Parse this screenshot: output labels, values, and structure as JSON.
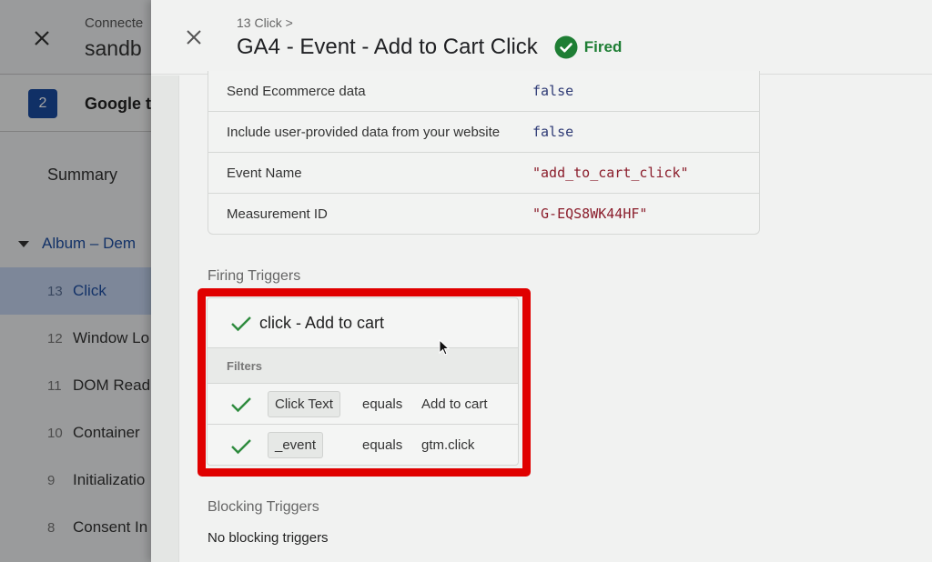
{
  "background_app": {
    "header": {
      "connected_label": "Connecte",
      "site_name": "sandb"
    },
    "container": {
      "badge": "2",
      "name": "Google t"
    },
    "summary_label": "Summary",
    "page_group": "Album – Dem",
    "events": [
      {
        "num": "13",
        "label": "Click",
        "active": true
      },
      {
        "num": "12",
        "label": "Window Lo"
      },
      {
        "num": "11",
        "label": "DOM Read"
      },
      {
        "num": "10",
        "label": "Container"
      },
      {
        "num": "9",
        "label": "Initializatio"
      },
      {
        "num": "8",
        "label": "Consent In"
      }
    ]
  },
  "panel": {
    "breadcrumb": "13 Click >",
    "title": "GA4 - Event - Add to Cart Click",
    "status": "Fired",
    "status_color": "#1e7e34",
    "properties": [
      {
        "key": "Send Ecommerce data",
        "value": "false",
        "type": "bool"
      },
      {
        "key": "Include user-provided data from your website",
        "value": "false",
        "type": "bool"
      },
      {
        "key": "Event Name",
        "value": "\"add_to_cart_click\"",
        "type": "str"
      },
      {
        "key": "Measurement ID",
        "value": "\"G-EQS8WK44HF\"",
        "type": "str"
      }
    ],
    "firing_triggers": {
      "label": "Firing Triggers",
      "trigger_name": "click - Add to cart",
      "filters_label": "Filters",
      "filters": [
        {
          "variable": "Click Text",
          "operator": "equals",
          "value": "Add to cart"
        },
        {
          "variable": "_event",
          "operator": "equals",
          "value": "gtm.click"
        }
      ]
    },
    "blocking_triggers": {
      "label": "Blocking Triggers",
      "empty_text": "No blocking triggers"
    },
    "highlight_color": "#e00000"
  }
}
